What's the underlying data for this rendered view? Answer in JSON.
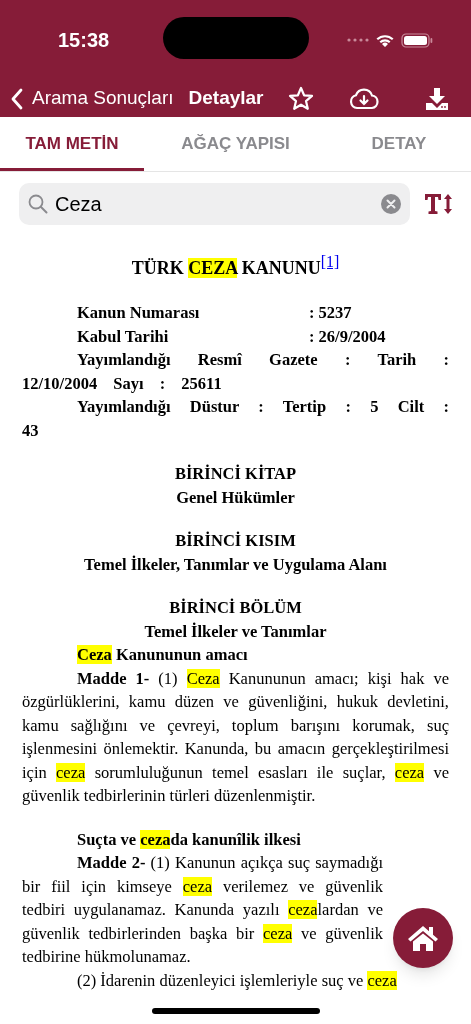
{
  "status_bar": {
    "time": "15:38"
  },
  "nav": {
    "back_label": "Arama Sonuçları",
    "title": "Detaylar"
  },
  "tabs": [
    {
      "label": "TAM METİN",
      "selected": true
    },
    {
      "label": "AĞAÇ YAPISI",
      "selected": false
    },
    {
      "label": "DETAY",
      "selected": false
    }
  ],
  "search": {
    "value": "Ceza"
  },
  "document": {
    "groups": [
      [
        {
          "kind": "title",
          "segments": [
            {
              "text": "TÜRK ",
              "highlight": false
            },
            {
              "text": "CEZA",
              "highlight": true
            },
            {
              "text": " KANUNU",
              "highlight": false
            }
          ],
          "footnote": "[1]"
        }
      ],
      [
        {
          "kind": "field",
          "label": "Kanun Numarası",
          "value": ": 5237"
        },
        {
          "kind": "field",
          "label": "Kabul Tarihi",
          "value": ": 26/9/2004"
        },
        {
          "kind": "meta",
          "text": "Yayımlandığı Resmî Gazete : Tarih : 12/10/2004 Sayı : 25611"
        },
        {
          "kind": "meta",
          "text": "Yayımlandığı Düstur : Tertip : 5 Cilt : 43"
        }
      ],
      [
        {
          "kind": "heading",
          "text": "BİRİNCİ KİTAP"
        },
        {
          "kind": "heading",
          "text": "Genel Hükümler"
        }
      ],
      [
        {
          "kind": "heading",
          "text": "BİRİNCİ KISIM"
        },
        {
          "kind": "heading",
          "text": "Temel İlkeler, Tanımlar ve Uygulama Alanı"
        }
      ],
      [
        {
          "kind": "heading",
          "text": "BİRİNCİ BÖLÜM"
        },
        {
          "kind": "heading",
          "text": "Temel İlkeler ve Tanımlar"
        },
        {
          "kind": "section_title",
          "segments": [
            {
              "text": "Ceza",
              "highlight": true
            },
            {
              "text": " Kanununun amacı",
              "highlight": false
            }
          ]
        },
        {
          "kind": "article",
          "segments": [
            {
              "text": "**Madde 1-** (1) ",
              "highlight": false
            },
            {
              "text": "Ceza",
              "highlight": true
            },
            {
              "text": " Kanununun amacı; kişi hak ve özgürlüklerini, kamu düzen ve güvenliğini, hukuk devletini, kamu sağlığını ve çevreyi, toplum barışını korumak, suç işlenmesini önlemektir. Kanunda, bu amacın gerçekleştirilmesi için ",
              "highlight": false
            },
            {
              "text": "ceza",
              "highlight": true
            },
            {
              "text": " sorumluluğunun temel esasları ile suçlar, ",
              "highlight": false
            },
            {
              "text": "ceza",
              "highlight": true
            },
            {
              "text": " ve güvenlik tedbirlerinin türleri düzenlenmiştir.",
              "highlight": false
            }
          ]
        }
      ],
      [
        {
          "kind": "section_title",
          "segments": [
            {
              "text": "Suçta ve ",
              "highlight": false
            },
            {
              "text": "ceza",
              "highlight": true
            },
            {
              "text": "da kanunîlik ilkesi",
              "highlight": false
            }
          ]
        },
        {
          "kind": "article",
          "segments": [
            {
              "text": "**Madde 2-** (1) Kanunun açıkça suç saymadığı bir fiil için kimseye ",
              "highlight": false
            },
            {
              "text": "ceza",
              "highlight": true
            },
            {
              "text": " verilemez ve güvenlik tedbiri uygulanamaz. Kanunda yazılı ",
              "highlight": false
            },
            {
              "text": "ceza",
              "highlight": true
            },
            {
              "text": "lardan ve güvenlik tedbirlerinden başka bir ",
              "highlight": false
            },
            {
              "text": "ceza",
              "highlight": true
            },
            {
              "text": " ve güvenlik tedbirine hükmolunamaz.",
              "highlight": false
            }
          ]
        },
        {
          "kind": "article",
          "segments": [
            {
              "text": "(2) İdarenin düzenleyici işlemleriyle suç ve ",
              "highlight": false
            },
            {
              "text": "ceza",
              "highlight": true
            }
          ]
        }
      ]
    ]
  }
}
